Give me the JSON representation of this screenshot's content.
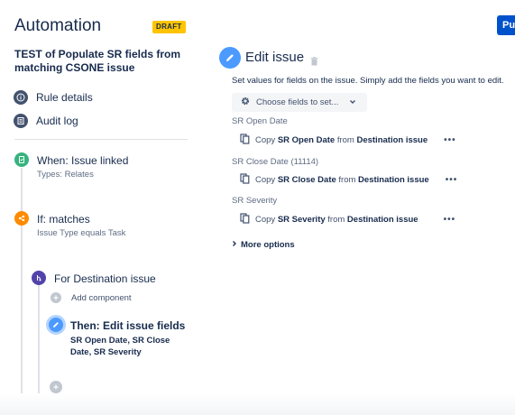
{
  "header": {
    "title": "Automation",
    "badge": "DRAFT",
    "publish_label": "Publish"
  },
  "rule": {
    "name": "TEST of Populate SR fields from matching CSONE issue"
  },
  "nav": {
    "items": [
      {
        "label": "Rule details",
        "icon": "info-icon"
      },
      {
        "label": "Audit log",
        "icon": "audit-log-icon"
      }
    ]
  },
  "flow": {
    "trigger": {
      "title": "When: Issue linked",
      "subtitle": "Types: Relates",
      "icon": "trigger-icon",
      "color": "#36b37e"
    },
    "condition": {
      "title": "If: matches",
      "subtitle": "Issue Type equals Task",
      "icon": "condition-icon",
      "color": "#ff8b00"
    },
    "branch": {
      "title": "For Destination issue",
      "icon": "branch-icon",
      "color": "#5243aa"
    },
    "add_component_label": "Add component",
    "action": {
      "title": "Then: Edit issue fields",
      "description": "SR Open Date, SR Close Date, SR Severity",
      "icon": "pencil-icon",
      "color": "#4c9aff"
    }
  },
  "panel": {
    "title": "Edit issue",
    "description": "Set values for fields on the issue. Simply add the fields you want to edit.",
    "choose_fields_label": "Choose fields to set...",
    "fields": [
      {
        "label": "SR Open Date",
        "copy_prefix": "Copy",
        "field": "SR Open Date",
        "from_word": "from",
        "source": "Destination issue"
      },
      {
        "label": "SR Close Date (11114)",
        "copy_prefix": "Copy",
        "field": "SR Close Date",
        "from_word": "from",
        "source": "Destination issue"
      },
      {
        "label": "SR Severity",
        "copy_prefix": "Copy",
        "field": "SR Severity",
        "from_word": "from",
        "source": "Destination issue"
      }
    ],
    "more_options_label": "More options",
    "more_label": "•••"
  }
}
